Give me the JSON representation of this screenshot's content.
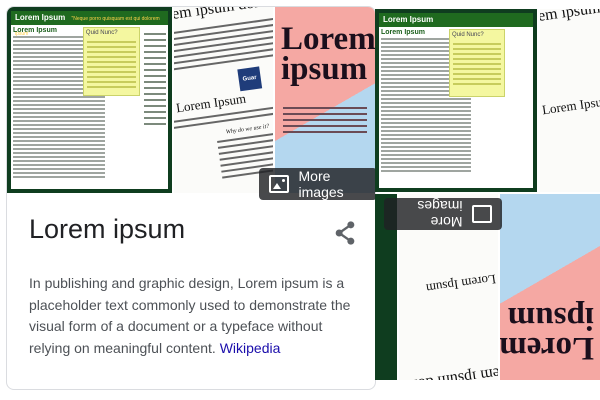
{
  "thumbnails": {
    "site": {
      "header_title": "Lorem Ipsum",
      "header_sub": "\"Neque porro quisquam est qui dolorem ipsum\"",
      "page_title": "Lorem Ipsum",
      "box_title": "Quid Nunc?"
    },
    "paper": {
      "headline": "Lorem ipsum dolor",
      "subhead": "Lorem Ipsum",
      "question": "Why do we use it?",
      "logo_text": "Guar"
    },
    "poster": {
      "line1": "Lorem",
      "line2": "ipsum"
    }
  },
  "more_images": {
    "label": "More images",
    "icon": "image-icon"
  },
  "panel": {
    "title": "Lorem ipsum",
    "share_icon": "share-icon",
    "description": "In publishing and graphic design, Lorem ipsum is a placeholder text commonly used to demonstrate the visual form of a document or a typeface without relying on meaningful content.",
    "source_link": "Wikipedia"
  },
  "colors": {
    "link": "#1a0dab",
    "text": "#4d5156",
    "title": "#202124",
    "border": "#dadce0"
  }
}
